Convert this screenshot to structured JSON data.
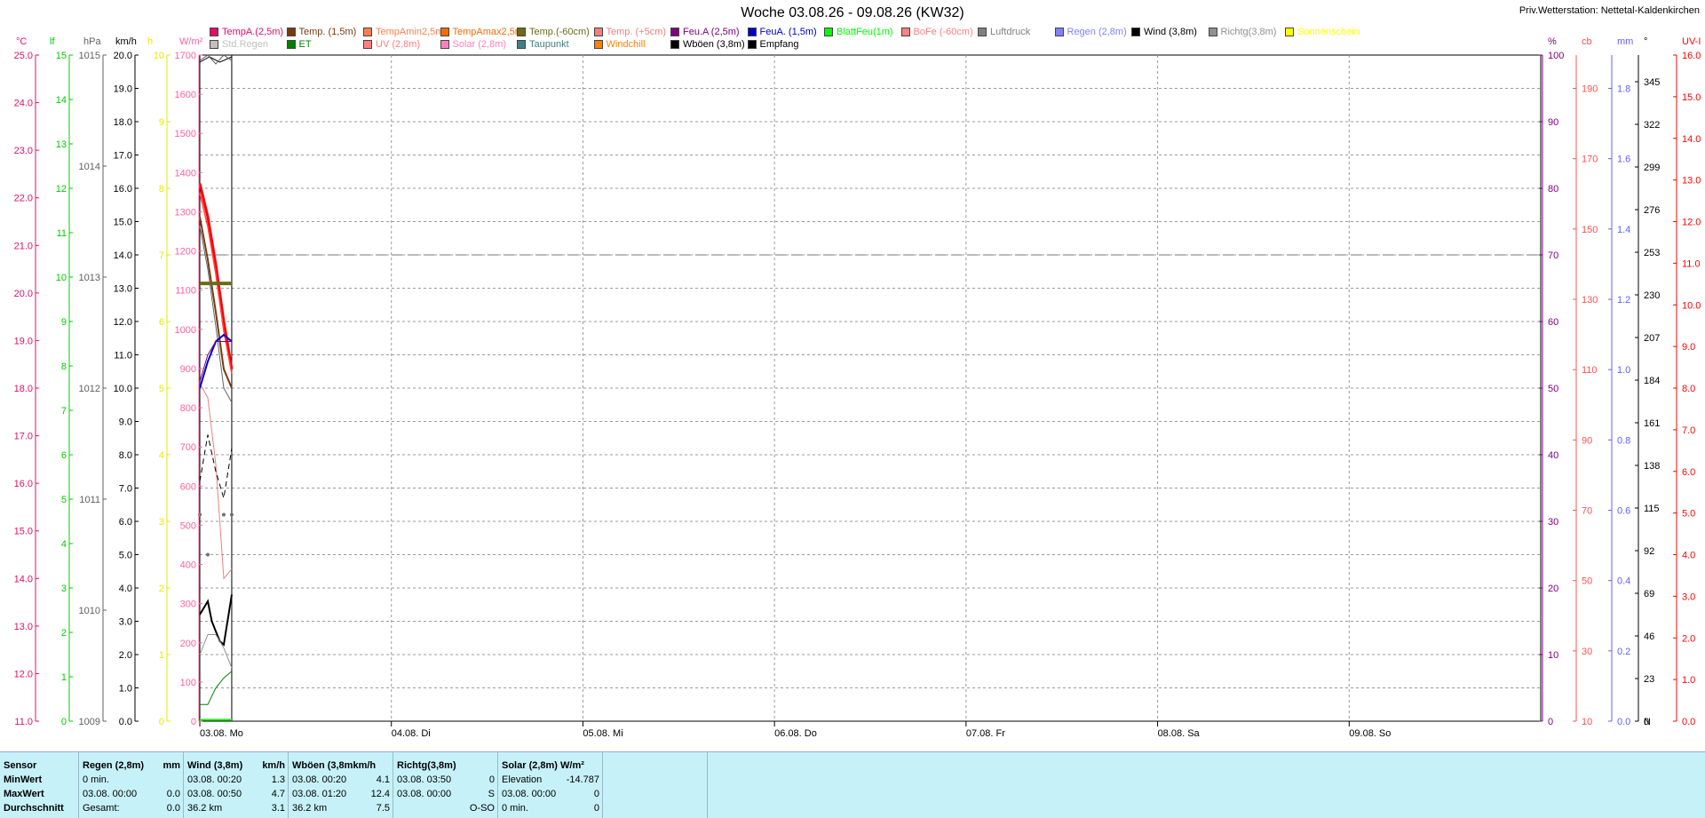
{
  "title": "Woche 03.08.26 - 09.08.26 (KW32)",
  "station": "Priv.Wetterstation: Nettetal-Kaldenkirchen",
  "legend": [
    {
      "label": "TempA.(2,5m)",
      "color": "#e0106a"
    },
    {
      "label": "Temp. (1,5m)",
      "color": "#7a3a10"
    },
    {
      "label": "TempAmin2,5m",
      "color": "#ff7f50"
    },
    {
      "label": "TempAmax2,5m",
      "color": "#ff6a00"
    },
    {
      "label": "Temp.(-60cm)",
      "color": "#6b6b1a"
    },
    {
      "label": "Temp. (+5cm)",
      "color": "#f08080"
    },
    {
      "label": "Feu.A (2,5m)",
      "color": "#800080"
    },
    {
      "label": "FeuA. (1,5m)",
      "color": "#0000cc"
    },
    {
      "label": "BlattFeu(1m)",
      "color": "#00ff00"
    },
    {
      "label": "BoFe (-60cm)",
      "color": "#ff8080"
    },
    {
      "label": "Luftdruck",
      "color": "#808080"
    },
    {
      "label": "Regen (2,8m)",
      "color": "#8080ff"
    },
    {
      "label": "Wind (3,8m)",
      "color": "#000000"
    },
    {
      "label": "Richtg(3,8m)",
      "color": "#909090"
    },
    {
      "label": "Sonnenschein",
      "color": "#ffff00"
    },
    {
      "label": "Std.Regen",
      "color": "#c0c0c0"
    },
    {
      "label": "ET",
      "color": "#008000"
    },
    {
      "label": "UV (2,8m)",
      "color": "#ff8080"
    },
    {
      "label": "Solar (2,8m)",
      "color": "#ff80c0"
    },
    {
      "label": "Taupunkt",
      "color": "#408080"
    },
    {
      "label": "Windchill",
      "color": "#ff8000"
    },
    {
      "label": "Wböen (3,8m)",
      "color": "#000000"
    },
    {
      "label": "Empfang",
      "color": "#000000"
    }
  ],
  "axes_left": [
    {
      "unit": "°C",
      "color": "#e0106a",
      "ticks": [
        "25.0",
        "24.0",
        "23.0",
        "22.0",
        "21.0",
        "20.0",
        "19.0",
        "18.0",
        "17.0",
        "16.0",
        "15.0",
        "14.0",
        "13.0",
        "12.0",
        "11.0"
      ]
    },
    {
      "unit": "lf",
      "color": "#00cc00",
      "ticks": [
        "15",
        "14",
        "13",
        "12",
        "11",
        "10",
        "9",
        "8",
        "7",
        "6",
        "5",
        "4",
        "3",
        "2",
        "1",
        "0"
      ]
    },
    {
      "unit": "hPa",
      "color": "#606060",
      "ticks": [
        "1015",
        "1014",
        "1013",
        "1012",
        "1011",
        "1010",
        "1009"
      ]
    },
    {
      "unit": "km/h",
      "color": "#000000",
      "ticks": [
        "20.0",
        "19.0",
        "18.0",
        "17.0",
        "16.0",
        "15.0",
        "14.0",
        "13.0",
        "12.0",
        "11.0",
        "10.0",
        "9.0",
        "8.0",
        "7.0",
        "6.0",
        "5.0",
        "4.0",
        "3.0",
        "2.0",
        "1.0",
        "0.0"
      ]
    },
    {
      "unit": "h",
      "color": "#e8e800",
      "ticks": [
        "10",
        "9",
        "8",
        "7",
        "6",
        "5",
        "4",
        "3",
        "2",
        "1",
        "0"
      ]
    },
    {
      "unit": "W/m²",
      "color": "#ff60a0",
      "ticks": [
        "1700",
        "1600",
        "1500",
        "1400",
        "1300",
        "1200",
        "1100",
        "1000",
        "900",
        "800",
        "700",
        "600",
        "500",
        "400",
        "300",
        "200",
        "100",
        "0"
      ]
    }
  ],
  "axes_right": [
    {
      "unit": "%",
      "color": "#800080",
      "ticks": [
        "100",
        "90",
        "80",
        "70",
        "60",
        "50",
        "40",
        "30",
        "20",
        "10",
        "0"
      ]
    },
    {
      "unit": "cb",
      "color": "#ff5050",
      "ticks": [
        "190",
        "170",
        "150",
        "130",
        "110",
        "90",
        "70",
        "50",
        "30",
        "10"
      ]
    },
    {
      "unit": "mm",
      "color": "#6060ff",
      "ticks": [
        "1.8",
        "1.6",
        "1.4",
        "1.2",
        "1.0",
        "0.8",
        "0.6",
        "0.4",
        "0.2",
        "0.0"
      ]
    },
    {
      "unit": "°",
      "color": "#000000",
      "ticks": [
        "345",
        "322",
        "299",
        "276",
        "253",
        "230",
        "207",
        "184",
        "161",
        "138",
        "115",
        "92",
        "69",
        "46",
        "23",
        "0"
      ],
      "bottom_label": "N"
    },
    {
      "unit": "UV-I",
      "color": "#ff0000",
      "ticks": [
        "16.0",
        "15.0",
        "14.0",
        "13.0",
        "12.0",
        "11.0",
        "10.0",
        "9.0",
        "8.0",
        "7.0",
        "6.0",
        "5.0",
        "4.0",
        "3.0",
        "2.0",
        "1.0",
        "0.0"
      ]
    }
  ],
  "chart_data": {
    "type": "line",
    "title": "Woche 03.08.26 - 09.08.26 (KW32)",
    "x_days": [
      "03.08. Mo",
      "04.08. Di",
      "05.08. Mi",
      "06.08. Do",
      "07.08. Fr",
      "08.08. Sa",
      "09.08. So"
    ],
    "x_hours_range": [
      0,
      168
    ],
    "grid": true,
    "reference_line": {
      "axis": "%",
      "value": 70
    },
    "series": [
      {
        "name": "TempA.(2,5m)",
        "axis": "°C",
        "color": "#ff0000",
        "width": 3,
        "x": [
          0,
          1,
          2,
          3,
          4
        ],
        "y": [
          22.3,
          21.6,
          20.6,
          19.4,
          18.4
        ]
      },
      {
        "name": "TempAmin2,5m",
        "axis": "°C",
        "color": "#ff4040",
        "width": 1.5,
        "x": [
          0,
          1,
          2,
          3,
          4
        ],
        "y": [
          22.1,
          21.4,
          20.4,
          19.2,
          18.3
        ]
      },
      {
        "name": "Temp. (1,5m)",
        "axis": "°C",
        "color": "#7a3a10",
        "width": 2,
        "x": [
          0,
          1,
          2,
          3,
          4
        ],
        "y": [
          21.6,
          20.7,
          19.6,
          18.4,
          18.0
        ]
      },
      {
        "name": "Temp.(-60cm)",
        "axis": "°C",
        "color": "#6b6b1a",
        "width": 4,
        "x": [
          0,
          4
        ],
        "y": [
          20.2,
          20.2
        ]
      },
      {
        "name": "Temp. (+5cm)",
        "axis": "°C",
        "color": "#f08080",
        "width": 1,
        "x": [
          0,
          1,
          2,
          3,
          4
        ],
        "y": [
          18.1,
          17.8,
          16.4,
          14.0,
          14.2
        ]
      },
      {
        "name": "Taupunkt",
        "axis": "°C",
        "color": "#666666",
        "width": 1,
        "x": [
          0,
          1,
          2,
          3,
          4
        ],
        "y": [
          21.4,
          20.5,
          19.3,
          18.0,
          17.7
        ]
      },
      {
        "name": "FeuA. (1,5m)",
        "axis": "%",
        "color": "#0000cc",
        "width": 2,
        "x": [
          0,
          1,
          2,
          3,
          4
        ],
        "y": [
          50,
          54,
          57,
          58,
          57
        ]
      },
      {
        "name": "Feu.A (2,5m)",
        "axis": "%",
        "color": "#800080",
        "width": 1,
        "x": [
          0,
          1,
          2,
          3,
          4
        ],
        "y": [
          51,
          55,
          57,
          57,
          57
        ]
      },
      {
        "name": "Wböen (3,8m)",
        "axis": "km/h",
        "color": "#000000",
        "width": 1,
        "dash": "6,4",
        "x": [
          0,
          1,
          2,
          3,
          4
        ],
        "y": [
          7.2,
          8.6,
          7.5,
          6.7,
          8.2
        ]
      },
      {
        "name": "Wind (3,8m)",
        "axis": "km/h",
        "color": "#000000",
        "width": 2,
        "x": [
          0,
          1,
          1.5,
          2.5,
          3,
          4
        ],
        "y": [
          3.2,
          3.6,
          3.0,
          2.4,
          2.3,
          3.8
        ]
      },
      {
        "name": "Richtg(3,8m)",
        "axis": "km/h",
        "color": "#909090",
        "width": 1,
        "x": [
          0,
          1,
          2,
          3,
          4
        ],
        "y": [
          2.0,
          2.6,
          2.6,
          2.2,
          1.6
        ]
      },
      {
        "name": "ET",
        "axis": "km/h",
        "color": "#008000",
        "width": 1,
        "x": [
          0,
          1,
          2,
          3,
          4
        ],
        "y": [
          0.5,
          0.5,
          1.0,
          1.3,
          1.5
        ]
      },
      {
        "name": "BlattFeu(1m)",
        "axis": "%",
        "color": "#00ff00",
        "width": 2,
        "x": [
          0,
          4
        ],
        "y": [
          0.2,
          0.2
        ]
      },
      {
        "name": "Luftdruck",
        "axis": "hPa",
        "color": "#606060",
        "width": 1,
        "x": [
          0,
          1,
          2,
          3,
          4
        ],
        "y": [
          1014.95,
          1015.0,
          1014.92,
          1015.0,
          1014.95
        ]
      }
    ],
    "scatter": [
      {
        "name": "Richtg(3,8m)",
        "axis": "km/h",
        "color": "#707070",
        "x": [
          0,
          1,
          3,
          4
        ],
        "y": [
          6.2,
          5.0,
          6.2,
          6.2
        ]
      }
    ]
  },
  "footer": {
    "headers": [
      "Sensor",
      "Regen (2,8m)",
      "mm",
      "Wind (3,8m)",
      "km/h",
      "Wböen (3,8mkm/h",
      "Richtg(3,8m)",
      "Solar (2,8m) W/m²"
    ],
    "labels": [
      "MinWert",
      "MaxWert",
      "Durchschnitt"
    ],
    "regen": [
      [
        "0 min.",
        ""
      ],
      [
        "03.08.  00:00",
        "0.0"
      ],
      [
        "Gesamt:",
        "0.0"
      ]
    ],
    "wind": [
      [
        "03.08.  00:20",
        "1.3"
      ],
      [
        "03.08.  00:50",
        "4.7"
      ],
      [
        "36.2 km",
        "3.1"
      ]
    ],
    "wboen": [
      [
        "03.08.  00:20",
        "4.1"
      ],
      [
        "03.08.  01:20",
        "12.4"
      ],
      [
        "36.2 km",
        "7.5"
      ]
    ],
    "richtg": [
      [
        "03.08.  03:50",
        "0"
      ],
      [
        "03.08.  00:00",
        "S"
      ],
      [
        "",
        "O-SO"
      ]
    ],
    "solar": [
      [
        "Elevation",
        "-14.787"
      ],
      [
        "03.08.  00:00",
        "0"
      ],
      [
        "0 min.",
        "0"
      ]
    ]
  }
}
